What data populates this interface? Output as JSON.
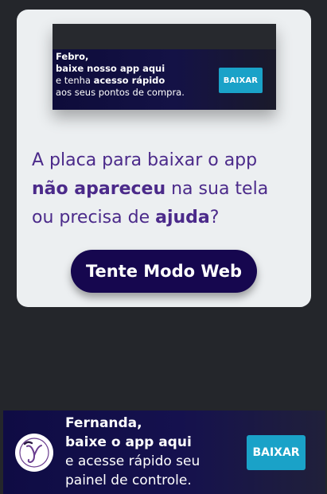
{
  "preview": {
    "line1": "Febro,",
    "line2": "baixe nosso app aqui",
    "line3_pre": "e tenha ",
    "line3_bold": "acesso rápido",
    "line4": "aos seus pontos de compra.",
    "button_label": "BAIXAR"
  },
  "message": {
    "line1": "A placa para baixar o app",
    "line2_bold": "não apareceu",
    "line2_rest": " na sua tela",
    "line3_pre": "ou precisa de ",
    "line3_bold": "ajuda",
    "line3_post": "?"
  },
  "web_button_label": "Tente Modo Web",
  "bottom_banner": {
    "line1": "Fernanda,",
    "line2": "baixe o app aqui",
    "line3": "e acesse rápido seu",
    "line4": "painel de controle.",
    "button_label": "BAIXAR",
    "logo_icon": "monogram-y-logo-icon"
  },
  "colors": {
    "background": "#24262b",
    "card": "#eceff1",
    "accent_purple": "#4b2a8a",
    "web_button": "#16074f",
    "download_button": "#1aa2c8",
    "banner": "#0f0c44"
  }
}
